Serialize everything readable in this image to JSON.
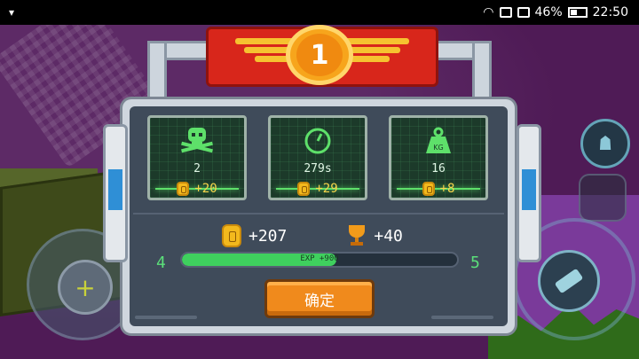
{
  "status_bar": {
    "battery": "46%",
    "time": "22:50"
  },
  "result": {
    "rank": "1",
    "stats": [
      {
        "icon": "skull-icon",
        "value": "2",
        "reward": "+20"
      },
      {
        "icon": "clock-icon",
        "value": "279s",
        "reward": "+29"
      },
      {
        "icon": "weight-icon",
        "value": "16",
        "reward": "+8"
      }
    ],
    "total_coins": "+207",
    "total_trophy": "+40",
    "level_current": "4",
    "level_next": "5",
    "exp_label": "EXP +900",
    "exp_progress": 0.56,
    "confirm_label": "确定"
  },
  "colors": {
    "accent_green": "#3fd05e",
    "coin": "#f3b91d",
    "confirm": "#f08a1c",
    "banner_red": "#d8261b"
  }
}
